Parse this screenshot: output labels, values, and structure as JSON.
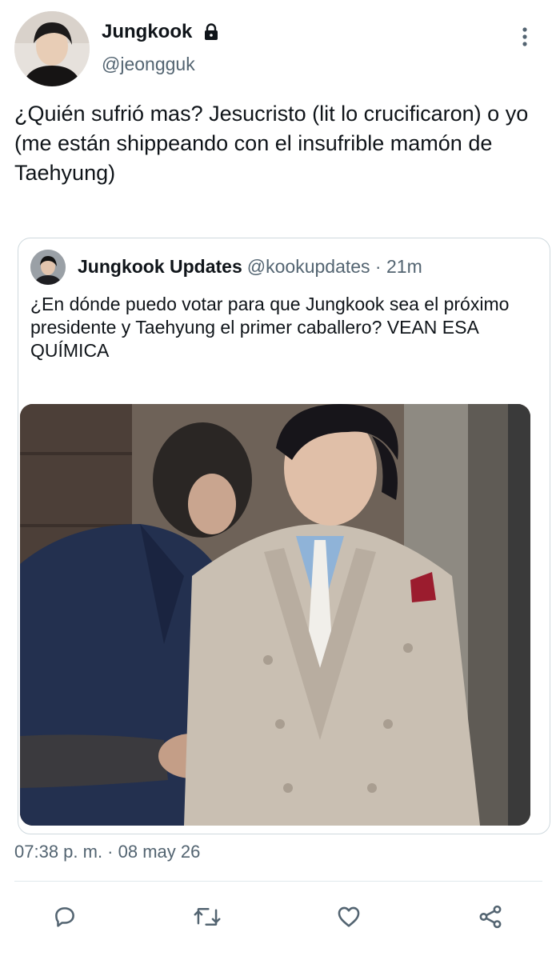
{
  "author": {
    "display_name": "Jungkook",
    "handle": "@jeongguk",
    "protected_icon": "lock-icon"
  },
  "tweet": {
    "text": "¿Quién sufrió mas? Jesucristo (lit lo crucificaron) o yo (me están shippeando con el insufrible mamón de Taehyung)",
    "timestamp": "07:38 p. m. · 08 may 26"
  },
  "quote": {
    "display_name": "Jungkook Updates",
    "meta": "@kookupdates · 21m",
    "text": "¿En dónde puedo votar para que Jungkook sea el próximo presidente y Taehyung el primer caballero? VEAN ESA QUÍMICA"
  },
  "actions": [
    {
      "icon": "reply-icon"
    },
    {
      "icon": "retweet-icon"
    },
    {
      "icon": "like-icon"
    },
    {
      "icon": "share-icon"
    }
  ],
  "colors": {
    "text": "#0f1419",
    "secondary": "#536471",
    "border": "#cfd9de"
  }
}
